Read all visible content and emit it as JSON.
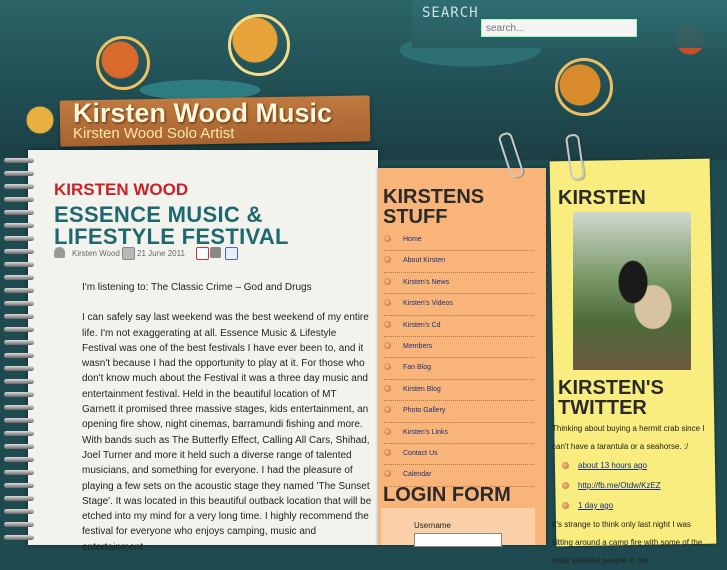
{
  "search": {
    "label": "SEARCH",
    "placeholder": "search..."
  },
  "site": {
    "title": "Kirsten Wood Music",
    "subtitle": "Kirsten Wood Solo Artist"
  },
  "post": {
    "category": "KIRSTEN WOOD",
    "title": "ESSENCE MUSIC & LIFESTYLE FESTIVAL",
    "author": "Kirsten Wood",
    "date": "21 June 2011",
    "paragraphs": [
      "I'm listening to: The Classic Crime – God and Drugs",
      "I can safely say last weekend was the best weekend of my entire life. I'm not exaggerating at all.  Essence Music & Lifestyle Festival was one of the best festivals I have ever been to, and it wasn't because I had the opportunity to play at it. For those who don't know much about the Festival it was a three day music and entertainment festival. Held in the beautiful location of MT Garnett it promised three massive stages, kids entertainment, an opening fire show, night cinemas, barramundi fishing and more. With bands such as The Butterfly Effect, Calling All Cars, Shihad, Joel Turner and more it held such a diverse range of talented musicians, and something for everyone. I had the pleasure of playing a few sets on the acoustic stage they named 'The Sunset Stage'. It was located in this beautiful outback location that will be etched into my mind for a very long time. I highly recommend the festival for everyone who enjoys camping, music and entertainment."
    ]
  },
  "stuff": {
    "heading_line1": "KIRSTENS",
    "heading_line2": "STUFF",
    "items": [
      "Home",
      "About Kirsten",
      "Kirsten's News",
      "Kirsten's Videos",
      "Kirsten's Cd",
      "Members",
      "Fan Blog",
      "Kirsten Blog",
      "Photo Gallery",
      "Kirsten's Links",
      "Contact Us",
      "Calendar"
    ]
  },
  "login": {
    "heading": "LOGIN FORM",
    "username_label": "Username"
  },
  "profile": {
    "heading": "KIRSTEN"
  },
  "twitter": {
    "heading_line1": "KIRSTEN'S",
    "heading_line2": "TWITTER",
    "tweet1": "Thinking about buying a hermit crab since I can't have a tarantula or a seahorse. :/",
    "link1": "about 13 hours ago",
    "link2": "http://fb.me/Otdw/KzEZ",
    "link3": "1 day ago",
    "tweet2": "It's strange to think only last night I was sitting around a camp fire with some of the most talented people in the"
  },
  "colors": {
    "category_red": "#cc2026",
    "title_teal": "#1f6870",
    "orange_panel": "#f9b47a",
    "yellow_panel": "#f8ed7e"
  }
}
